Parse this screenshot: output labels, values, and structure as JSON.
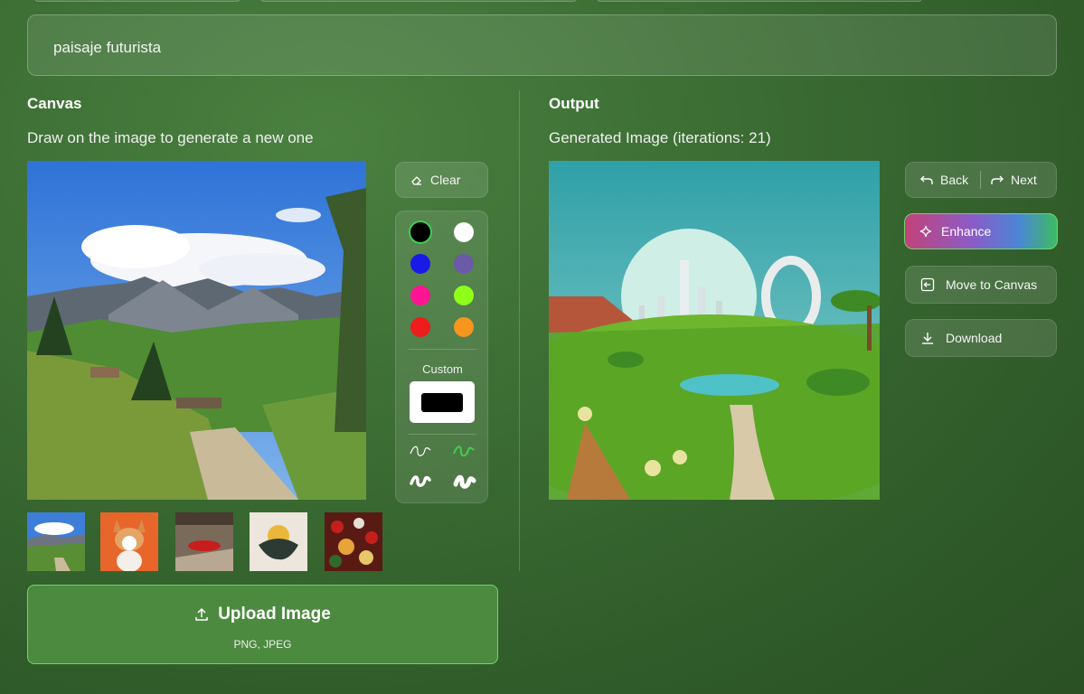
{
  "prompt": {
    "value": "paisaje futurista"
  },
  "canvas": {
    "title": "Canvas",
    "subtitle": "Draw on the image to generate a new one",
    "clear_label": "Clear",
    "palette": {
      "colors": [
        "#000000",
        "#ffffff",
        "#1a1ae6",
        "#6a5aa8",
        "#ff1493",
        "#8fff1a",
        "#ee1c1c",
        "#f5961e"
      ],
      "selected": "#000000",
      "custom_label": "Custom",
      "custom_color": "#000000"
    },
    "thumbnails": [
      "mountain-trail-thumbnail",
      "corgi-dog-thumbnail",
      "red-car-thumbnail",
      "sunset-art-thumbnail",
      "food-platter-thumbnail"
    ],
    "upload_label": "Upload Image",
    "upload_hint": "PNG, JPEG"
  },
  "output": {
    "title": "Output",
    "subtitle": "Generated Image (iterations: 21)",
    "back_label": "Back",
    "next_label": "Next",
    "enhance_label": "Enhance",
    "move_label": "Move to Canvas",
    "download_label": "Download"
  },
  "colors": {
    "accent": "#6fd66a",
    "upload_bg": "#4c8a3f"
  }
}
